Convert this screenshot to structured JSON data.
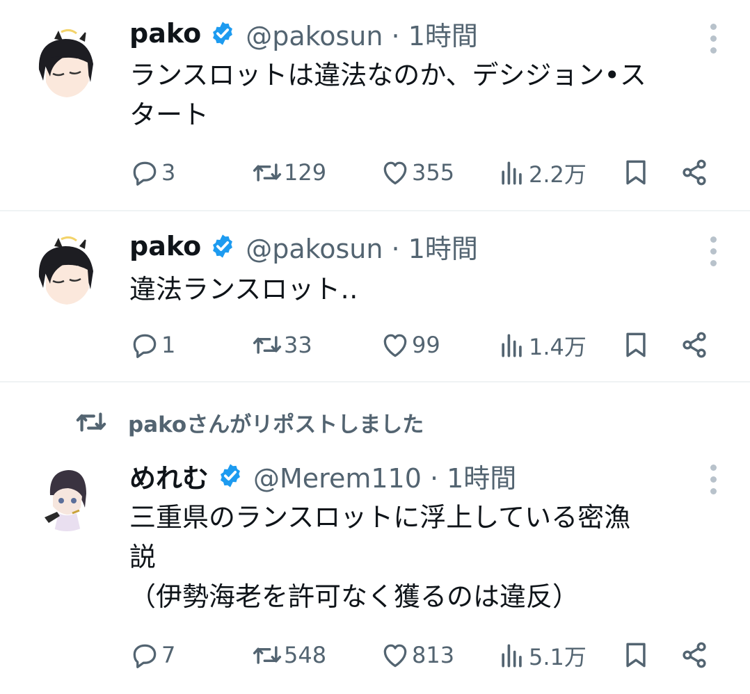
{
  "tweets": [
    {
      "name": "pako",
      "handle": "@pakosun · 1時間",
      "text_lines": [
        "ランスロットは違法なのか、デシジョン•ス",
        "タート"
      ],
      "replies": "3",
      "reposts": "129",
      "likes": "355",
      "views": "2.2万"
    },
    {
      "name": "pako",
      "handle": "@pakosun · 1時間",
      "text_lines": [
        "違法ランスロット‥"
      ],
      "replies": "1",
      "reposts": "33",
      "likes": "99",
      "views": "1.4万"
    },
    {
      "repost_label": "pakoさんがリポストしました",
      "name": "めれむ",
      "handle": "@Merem110 · 1時間",
      "text_lines": [
        "三重県のランスロットに浮上している密漁",
        "説",
        "（伊勢海老を許可なく獲るのは違反）"
      ],
      "replies": "7",
      "reposts": "548",
      "likes": "813",
      "views": "5.1万"
    }
  ],
  "colors": {
    "text": "#0f1419",
    "secondary": "#536471",
    "verified": "#1d9bf0",
    "divider": "#eff3f4"
  },
  "icons": [
    "reply-icon",
    "repost-icon",
    "like-icon",
    "views-icon",
    "bookmark-icon",
    "share-icon",
    "more-icon",
    "verified-badge-icon"
  ]
}
